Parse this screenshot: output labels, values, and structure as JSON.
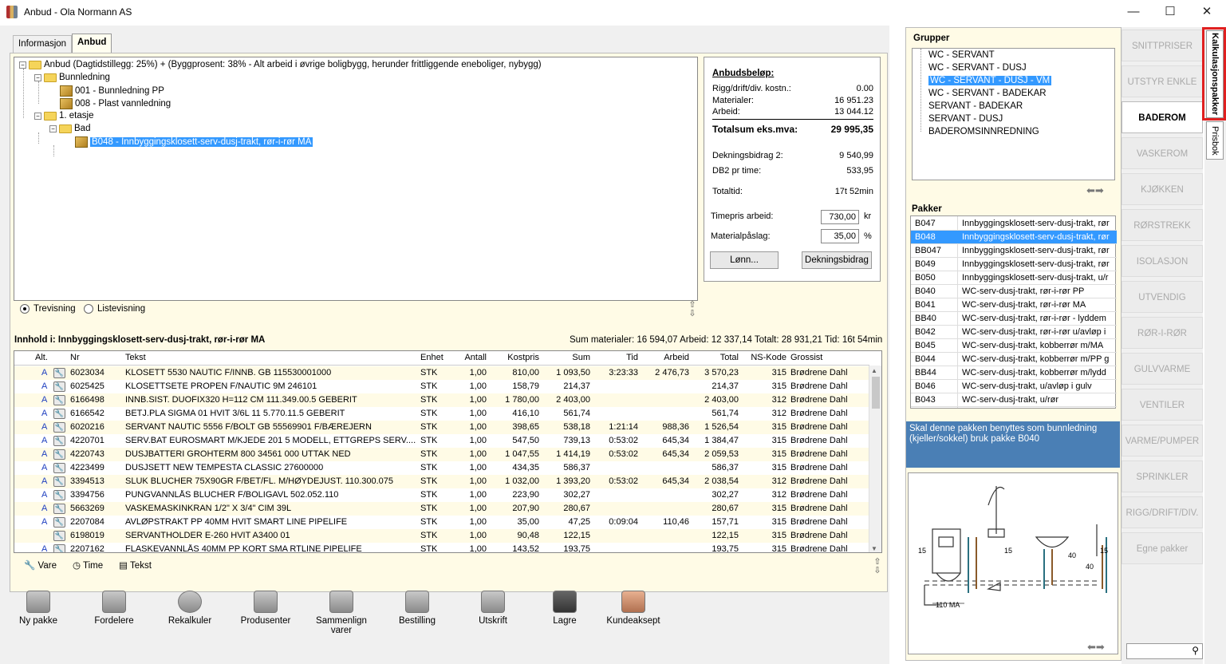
{
  "window": {
    "title": "Anbud - Ola Normann AS",
    "minimize": "—",
    "maximize": "☐",
    "close": "✕"
  },
  "tabs": [
    "Informasjon",
    "Anbud"
  ],
  "tree": {
    "root": "Anbud (Dagtidstillegg: 25%) + (Byggprosent: 38% - Alt arbeid i øvrige boligbygg, herunder frittliggende eneboliger, nybygg)",
    "n1": "Bunnledning",
    "n1a": "001 - Bunnledning PP",
    "n1b": "008 - Plast vannledning",
    "n2": "1. etasje",
    "n2a": "Bad",
    "n2a1": "B048 - Innbyggingsklosett-serv-dusj-trakt, rør-i-rør MA"
  },
  "summary": {
    "heading": "Anbudsbeløp:",
    "rigg_label": "Rigg/drift/div. kostn.:",
    "rigg": "0.00",
    "mat_label": "Materialer:",
    "mat": "16 951.23",
    "arb_label": "Arbeid:",
    "arb": "13 044.12",
    "tot_label": "Totalsum eks.mva:",
    "tot": "29 995,35",
    "db_label": "Dekningsbidrag 2:",
    "db": "9 540,99",
    "dbt_label": "DB2 pr time:",
    "dbt": "533,95",
    "tt_label": "Totaltid:",
    "tt": "17t 52min",
    "timepris_label": "Timepris arbeid:",
    "timepris": "730,00",
    "timepris_unit": "kr",
    "paslag_label": "Materialpåslag:",
    "paslag": "35,00",
    "paslag_unit": "%",
    "lonn_btn": "Lønn...",
    "db_btn": "Dekningsbidrag"
  },
  "view": {
    "tree": "Trevisning",
    "list": "Listevisning"
  },
  "content": {
    "header": "Innhold i: Innbyggingsklosett-serv-dusj-trakt, rør-i-rør MA",
    "sums": "Sum materialer:  16 594,07  Arbeid:  12 337,14  Totalt:  28 931,21  Tid: 16t 54min"
  },
  "columns": [
    "Alt.",
    "Nr",
    "Tekst",
    "Enhet",
    "Antall",
    "Kostpris",
    "Sum",
    "Tid",
    "Arbeid",
    "Total",
    "NS-Kode",
    "Grossist"
  ],
  "rows": [
    [
      "A",
      "6023034",
      "KLOSETT 5530 NAUTIC F/INNB. GB 115530001000",
      "STK",
      "1,00",
      "810,00",
      "1 093,50",
      "3:23:33",
      "2 476,73",
      "3 570,23",
      "315",
      "Brødrene Dahl"
    ],
    [
      "A",
      "6025425",
      "KLOSETTSETE PROPEN F/NAUTIC 9M 246101",
      "STK",
      "1,00",
      "158,79",
      "214,37",
      "",
      "",
      "214,37",
      "315",
      "Brødrene Dahl"
    ],
    [
      "A",
      "6166498",
      "INNB.SIST. DUOFIX320 H=112 CM 111.349.00.5 GEBERIT",
      "STK",
      "1,00",
      "1 780,00",
      "2 403,00",
      "",
      "",
      "2 403,00",
      "312",
      "Brødrene Dahl"
    ],
    [
      "A",
      "6166542",
      "BETJ.PLA SIGMA 01 HVIT 3/6L 11 5.770.11.5 GEBERIT",
      "STK",
      "1,00",
      "416,10",
      "561,74",
      "",
      "",
      "561,74",
      "312",
      "Brødrene Dahl"
    ],
    [
      "A",
      "6020216",
      "SERVANT NAUTIC 5556 F/BOLT GB 55569901 F/BÆREJERN",
      "STK",
      "1,00",
      "398,65",
      "538,18",
      "1:21:14",
      "988,36",
      "1 526,54",
      "315",
      "Brødrene Dahl"
    ],
    [
      "A",
      "4220701",
      "SERV.BAT EUROSMART M/KJEDE 201 5 MODELL, ETTGREPS SERV....",
      "STK",
      "1,00",
      "547,50",
      "739,13",
      "0:53:02",
      "645,34",
      "1 384,47",
      "315",
      "Brødrene Dahl"
    ],
    [
      "A",
      "4220743",
      "DUSJBATTERI GROHTERM 800 34561 000 UTTAK NED",
      "STK",
      "1,00",
      "1 047,55",
      "1 414,19",
      "0:53:02",
      "645,34",
      "2 059,53",
      "315",
      "Brødrene Dahl"
    ],
    [
      "A",
      "4223499",
      "DUSJSETT NEW TEMPESTA CLASSIC 27600000",
      "STK",
      "1,00",
      "434,35",
      "586,37",
      "",
      "",
      "586,37",
      "315",
      "Brødrene Dahl"
    ],
    [
      "A",
      "3394513",
      "SLUK BLUCHER 75X90GR F/BET/FL. M/HØYDEJUST.       110.300.075",
      "STK",
      "1,00",
      "1 032,00",
      "1 393,20",
      "0:53:02",
      "645,34",
      "2 038,54",
      "312",
      "Brødrene Dahl"
    ],
    [
      "A",
      "3394756",
      "PUNGVANNLÅS BLUCHER F/BOLIGAVL 502.052.110",
      "STK",
      "1,00",
      "223,90",
      "302,27",
      "",
      "",
      "302,27",
      "312",
      "Brødrene Dahl"
    ],
    [
      "A",
      "5663269",
      "VASKEMASKINKRAN    1/2\" X 3/4\" CIM 39L",
      "STK",
      "1,00",
      "207,90",
      "280,67",
      "",
      "",
      "280,67",
      "315",
      "Brødrene Dahl"
    ],
    [
      "A",
      "2207084",
      "AVLØPSTRAKT PP 40MM HVIT SMART LINE PIPELIFE",
      "STK",
      "1,00",
      "35,00",
      "47,25",
      "0:09:04",
      "110,46",
      "157,71",
      "315",
      "Brødrene Dahl"
    ],
    [
      "",
      "6198019",
      "SERVANTHOLDER E-260 HVIT A3400 01",
      "STK",
      "1,00",
      "90,48",
      "122,15",
      "",
      "",
      "122,15",
      "315",
      "Brødrene Dahl"
    ],
    [
      "A",
      "2207162",
      "FLASKEVANNLÅS 40MM PP KORT SMA RTLINE PIPELIFE",
      "STK",
      "1,00",
      "143,52",
      "193,75",
      "",
      "",
      "193,75",
      "315",
      "Brødrene Dahl"
    ]
  ],
  "legend": {
    "vare": "Vare",
    "time": "Time",
    "tekst": "Tekst"
  },
  "toolbar": [
    "Ny pakke",
    "Fordelere",
    "Rekalkuler",
    "Produsenter",
    "Sammenlign varer",
    "Bestilling",
    "Utskrift",
    "Lagre",
    "Kundeaksept"
  ],
  "groups": {
    "heading": "Grupper",
    "items": [
      "WC - SERVANT",
      "WC - SERVANT - DUSJ",
      "WC - SERVANT - DUSJ - VM",
      "WC - SERVANT - BADEKAR",
      "SERVANT - BADEKAR",
      "SERVANT - DUSJ",
      "BADEROMSINNREDNING"
    ]
  },
  "pakker": {
    "heading": "Pakker",
    "rows": [
      [
        "B047",
        "Innbyggingsklosett-serv-dusj-trakt, rør"
      ],
      [
        "B048",
        "Innbyggingsklosett-serv-dusj-trakt, rør"
      ],
      [
        "BB047",
        "Innbyggingsklosett-serv-dusj-trakt, rør"
      ],
      [
        "B049",
        "Innbyggingsklosett-serv-dusj-trakt, rør"
      ],
      [
        "B050",
        "Innbyggingsklosett-serv-dusj-trakt, u/r"
      ],
      [
        "B040",
        "WC-serv-dusj-trakt, rør-i-rør PP"
      ],
      [
        "B041",
        "WC-serv-dusj-trakt, rør-i-rør MA"
      ],
      [
        "BB40",
        "WC-serv-dusj-trakt, rør-i-rør - lyddem"
      ],
      [
        "B042",
        "WC-serv-dusj-trakt, rør-i-rør u/avløp i"
      ],
      [
        "B045",
        "WC-serv-dusj-trakt, kobberrør m/MA"
      ],
      [
        "B044",
        "WC-serv-dusj-trakt, kobberrør m/PP g"
      ],
      [
        "BB44",
        "WC-serv-dusj-trakt, kobberrør m/lydd"
      ],
      [
        "B046",
        "WC-serv-dusj-trakt, u/avløp i gulv"
      ],
      [
        "B043",
        "WC-serv-dusj-trakt, u/rør"
      ]
    ]
  },
  "info_text": "Skal denne pakken benyttes som bunnledning (kjeller/sokkel) bruk pakke B040",
  "diagram_labels": {
    "a": "15",
    "b": "15",
    "c": "40",
    "d": "40",
    "e": "15",
    "f": "110 MA"
  },
  "categories": [
    "SNITTPRISER",
    "UTSTYR  ENKLE",
    "BADEROM",
    "VASKEROM",
    "KJØKKEN",
    "RØRSTREKK",
    "ISOLASJON",
    "UTVENDIG",
    "RØR-I-RØR",
    "GULVVARME",
    "VENTILER",
    "VARME/PUMPER",
    "SPRINKLER",
    "RIGG/DRIFT/DIV.",
    "Egne pakker"
  ],
  "vtabs": [
    "Kalkulasjonspakker",
    "Prisbok"
  ],
  "colors": {
    "selection": "#3399ff",
    "info_bg": "#4a7fb5",
    "panel_bg": "#fffbe6",
    "highlight": "#e02020"
  }
}
